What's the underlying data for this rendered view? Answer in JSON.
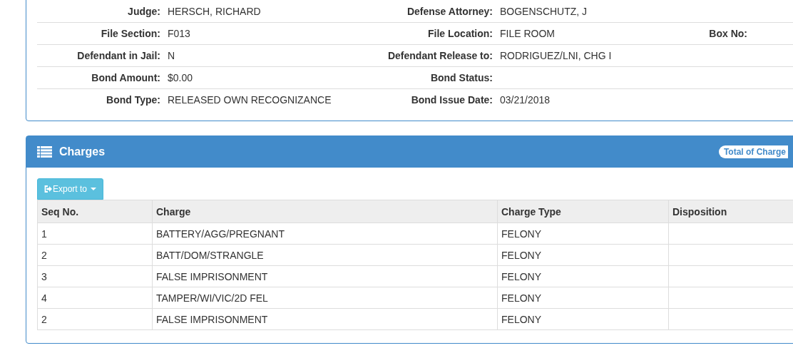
{
  "case_details": {
    "rows": [
      [
        {
          "label": "Judge:",
          "value": "HERSCH, RICHARD"
        },
        {
          "label": "Defense Attorney:",
          "value": "BOGENSCHUTZ, J"
        }
      ],
      [
        {
          "label": "File Section:",
          "value": "F013"
        },
        {
          "label": "File Location:",
          "value": "FILE ROOM"
        },
        {
          "label": "Box No:"
        }
      ],
      [
        {
          "label": "Defendant in Jail:",
          "value": "N"
        },
        {
          "label": "Defendant Release to:",
          "value": "RODRIGUEZ/LNI, CHG I"
        }
      ],
      [
        {
          "label": "Bond Amount:",
          "value": "$0.00"
        },
        {
          "label": "Bond Status:"
        }
      ],
      [
        {
          "label": "Bond Type:",
          "value": "RELEASED OWN RECOGNIZANCE"
        },
        {
          "label": "Bond Issue Date:",
          "value": "03/21/2018"
        }
      ]
    ]
  },
  "charges": {
    "title": "Charges",
    "total_badge": "Total of Charge",
    "export_button": "Export to",
    "table": {
      "columns": [
        "Seq No.",
        "Charge",
        "Charge Type",
        "Disposition"
      ],
      "rows": [
        [
          "1",
          "BATTERY/AGG/PREGNANT",
          "FELONY",
          ""
        ],
        [
          "2",
          "BATT/DOM/STRANGLE",
          "FELONY",
          ""
        ],
        [
          "3",
          "FALSE IMPRISONMENT",
          "FELONY",
          ""
        ],
        [
          "4",
          "TAMPER/WI/VIC/2D FEL",
          "FELONY",
          ""
        ],
        [
          "2",
          "FALSE IMPRISONMENT",
          "FELONY",
          ""
        ]
      ]
    }
  }
}
